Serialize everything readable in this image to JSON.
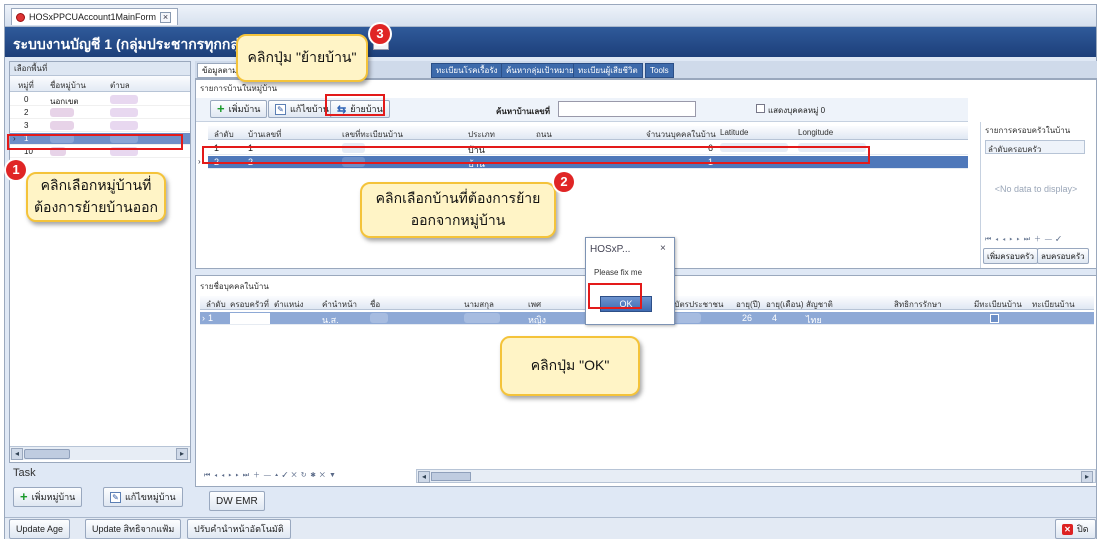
{
  "window": {
    "tab_title": "HOSxPPCUAccount1MainForm",
    "tab_close": "×",
    "title": "ระบบงานบัญชี 1 (กลุ่มประชากรทุกกลุ่มอายุ)",
    "title_dropdown": "▾"
  },
  "left_panel": {
    "header": "เลือกพื้นที่",
    "columns": [
      "หมู่ที่",
      "ชื่อหมู่บ้าน",
      "ตำบล"
    ],
    "villages": [
      {
        "moo": "0",
        "name": "นอกเขต",
        "tambon": "xxxxxxx"
      },
      {
        "moo": "2",
        "name": "xxxxxx",
        "tambon": "xxxxxxx"
      },
      {
        "moo": "3",
        "name": "xxxxxx",
        "tambon": "xxxxxxx"
      },
      {
        "moo": "1",
        "name": "xxxxxx",
        "tambon": "xxxxxxx"
      },
      {
        "moo": "10",
        "name": "xxxx",
        "tambon": "xxxxxxx"
      }
    ],
    "task_label": "Task",
    "add_village_label": "เพิ่มหมู่บ้าน",
    "edit_village_label": "แก้ไขหมู่บ้าน"
  },
  "main_tabs": [
    "ข้อมูลตามหมู่บ้าน",
    "",
    "",
    "ทะเบียนโรคเรื้อรัง",
    "ค้นหากลุ่มเป้าหมาย",
    "ทะเบียนผู้เสียชีวิต",
    "Tools"
  ],
  "house_section": {
    "title": "รายการบ้านในหมู่บ้าน",
    "add_house_label": "เพิ่มบ้าน",
    "edit_house_label": "แก้ไขบ้าน",
    "move_house_label": "ย้ายบ้าน",
    "search_label": "ค้นหาบ้านเลขที่",
    "search_value": "",
    "show_persons_label": "แสดงบุคคลหมู่ 0",
    "columns": [
      "ลำดับ",
      "บ้านเลขที่",
      "เลขที่ทะเบียนบ้าน",
      "ประเภท",
      "ถนน",
      "จำนวนบุคคลในบ้าน",
      "Latitude",
      "Longitude"
    ],
    "rows": [
      {
        "no": "1",
        "house_no": "1",
        "reg": "xxxxx",
        "type": "บ้าน",
        "road": "",
        "persons": "6"
      },
      {
        "no": "2",
        "house_no": "2",
        "reg": "xxxxx",
        "type": "บ้าน",
        "road": "",
        "persons": "1"
      }
    ]
  },
  "family_panel": {
    "title": "รายการครอบครัวในบ้าน",
    "column": "ลำดับครอบครัว",
    "empty": "<No data to display>",
    "add_label": "เพิ่มครอบครัว",
    "delete_label": "ลบครอบครัว"
  },
  "person_section": {
    "title": "รายชื่อบุคคลในบ้าน",
    "columns": [
      "ลำดับ",
      "ครอบครัวที่",
      "ตำแหน่ง",
      "คำนำหน้า",
      "ชื่อ",
      "นามสกุล",
      "เพศ",
      "เลขที่บัตรประชาชน",
      "อายุ(ปี)",
      "อายุ(เดือน)",
      "สัญชาติ",
      "สิทธิการรักษา",
      "มีทะเบียนบ้าน",
      "ทะเบียนบ้าน"
    ],
    "rows": [
      {
        "no": "1",
        "family": "",
        "position": "",
        "prefix": "น.ส.",
        "fname": "xxxx",
        "lname": "xxxxxxxx",
        "sex": "หญิง",
        "cid": "xxxxxxxxxx",
        "age_y": "26",
        "age_m": "4",
        "nation": "ไทย",
        "right": ""
      }
    ]
  },
  "dialog": {
    "title": "HOSxP...",
    "close": "×",
    "message": "Please fix me",
    "ok_label": "OK"
  },
  "bottom": {
    "dwemr_label": "DW EMR",
    "update_age_label": "Update Age",
    "update_right_label": "Update สิทธิจากแฟ้ม",
    "adjust_prefix_label": "ปรับคำนำหน้าอัตโนมัติ",
    "close_label": "ปิด"
  },
  "annotations": {
    "step1_number": "1",
    "step1_text_line1": "คลิกเลือกหมู่บ้านที่",
    "step1_text_line2": "ต้องการย้ายบ้านออก",
    "step2_number": "2",
    "step2_text_line1": "คลิกเลือกบ้านที่ต้องการย้าย",
    "step2_text_line2": "ออกจากหมู่บ้าน",
    "step3_number": "3",
    "step3_text": "คลิกปุ่ม \"ย้ายบ้าน\"",
    "step4_text": "คลิกปุ่ม \"OK\"",
    "accent_red": "#e31a1a",
    "callout_fill": "#fff4c6"
  }
}
